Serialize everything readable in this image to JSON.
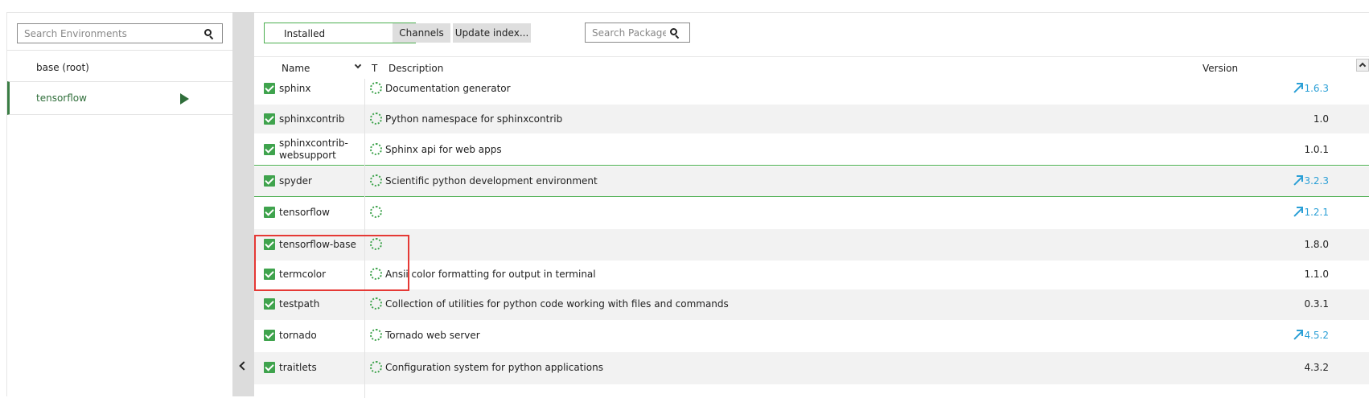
{
  "environments": {
    "search_placeholder": "Search Environments",
    "items": [
      {
        "label": "base (root)",
        "selected": false
      },
      {
        "label": "tensorflow",
        "selected": true
      }
    ]
  },
  "toolbar": {
    "filter_selected": "Installed",
    "channels_label": "Channels",
    "update_index_label": "Update index...",
    "search_placeholder": "Search Packages"
  },
  "table": {
    "headers": {
      "name": "Name",
      "type": "T",
      "description": "Description",
      "version": "Version"
    },
    "rows": [
      {
        "name": "sphinx",
        "description": "Documentation generator",
        "version": "1.6.3",
        "update": true
      },
      {
        "name": "sphinxcontrib",
        "description": "Python namespace for sphinxcontrib",
        "version": "1.0",
        "update": false
      },
      {
        "name": "sphinxcontrib-websupport",
        "description": "Sphinx api for web apps",
        "version": "1.0.1",
        "update": false
      },
      {
        "name": "spyder",
        "description": "Scientific python development environment",
        "version": "3.2.3",
        "update": true
      },
      {
        "name": "tensorflow",
        "description": "",
        "version": "1.2.1",
        "update": true
      },
      {
        "name": "tensorflow-base",
        "description": "",
        "version": "1.8.0",
        "update": false
      },
      {
        "name": "termcolor",
        "description": "Ansii color formatting for output in terminal",
        "version": "1.1.0",
        "update": false
      },
      {
        "name": "testpath",
        "description": "Collection of utilities for python code working with files and commands",
        "version": "0.3.1",
        "update": false
      },
      {
        "name": "tornado",
        "description": "Tornado web server",
        "version": "4.5.2",
        "update": true
      },
      {
        "name": "traitlets",
        "description": "Configuration system for python applications",
        "version": "4.3.2",
        "update": false
      }
    ]
  },
  "colors": {
    "accent_green": "#3fa34d",
    "update_blue": "#2a9fd6",
    "highlight_red": "#e53935"
  }
}
